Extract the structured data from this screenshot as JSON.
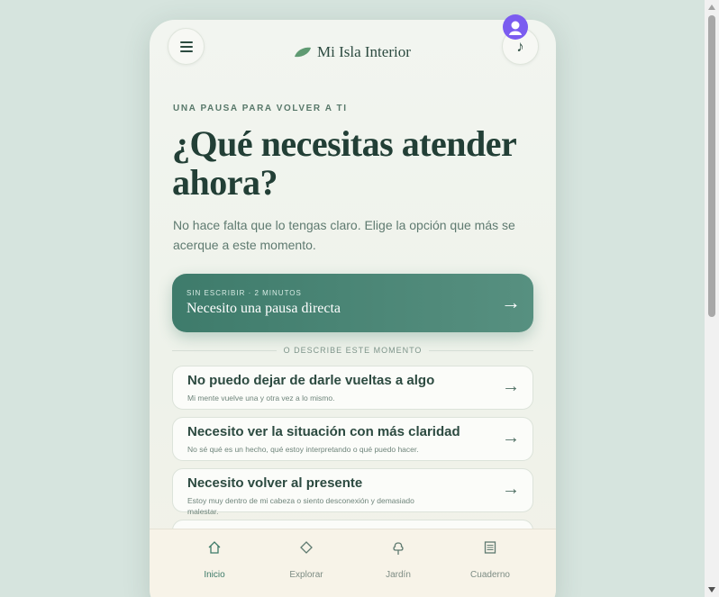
{
  "header": {
    "brand": "Mi Isla Interior",
    "menu_icon": "hamburger-icon",
    "music_icon": "music-note-icon",
    "music_glyph": "♪"
  },
  "hero": {
    "eyebrow": "UNA PAUSA PARA VOLVER A TI",
    "title": "¿Qué necesitas atender ahora?",
    "lede": "No hace falta que lo tengas claro. Elige la opción que más se acerque a este momento."
  },
  "primary": {
    "kicker": "SIN ESCRIBIR · 2 MINUTOS",
    "title": "Necesito una pausa directa",
    "arrow": "→"
  },
  "divider": "O DESCRIBE ESTE MOMENTO",
  "options": [
    {
      "title": "No puedo dejar de darle vueltas a algo",
      "subtitle": "Mi mente vuelve una y otra vez a lo mismo.",
      "arrow": "→"
    },
    {
      "title": "Necesito ver la situación con más claridad",
      "subtitle": "No sé qué es un hecho, qué estoy interpretando o qué puedo hacer.",
      "arrow": "→"
    },
    {
      "title": "Necesito volver al presente",
      "subtitle": "Estoy muy dentro de mi cabeza o siento desconexión y demasiado malestar.",
      "arrow": "→"
    }
  ],
  "nav": [
    {
      "label": "Inicio",
      "icon": "home-icon"
    },
    {
      "label": "Explorar",
      "icon": "diamond-icon"
    },
    {
      "label": "Jardín",
      "icon": "tree-icon"
    },
    {
      "label": "Cuaderno",
      "icon": "notebook-icon"
    }
  ],
  "colors": {
    "accent": "#3e7b6b",
    "avatar": "#7b5cf0",
    "text": "#223f36"
  }
}
